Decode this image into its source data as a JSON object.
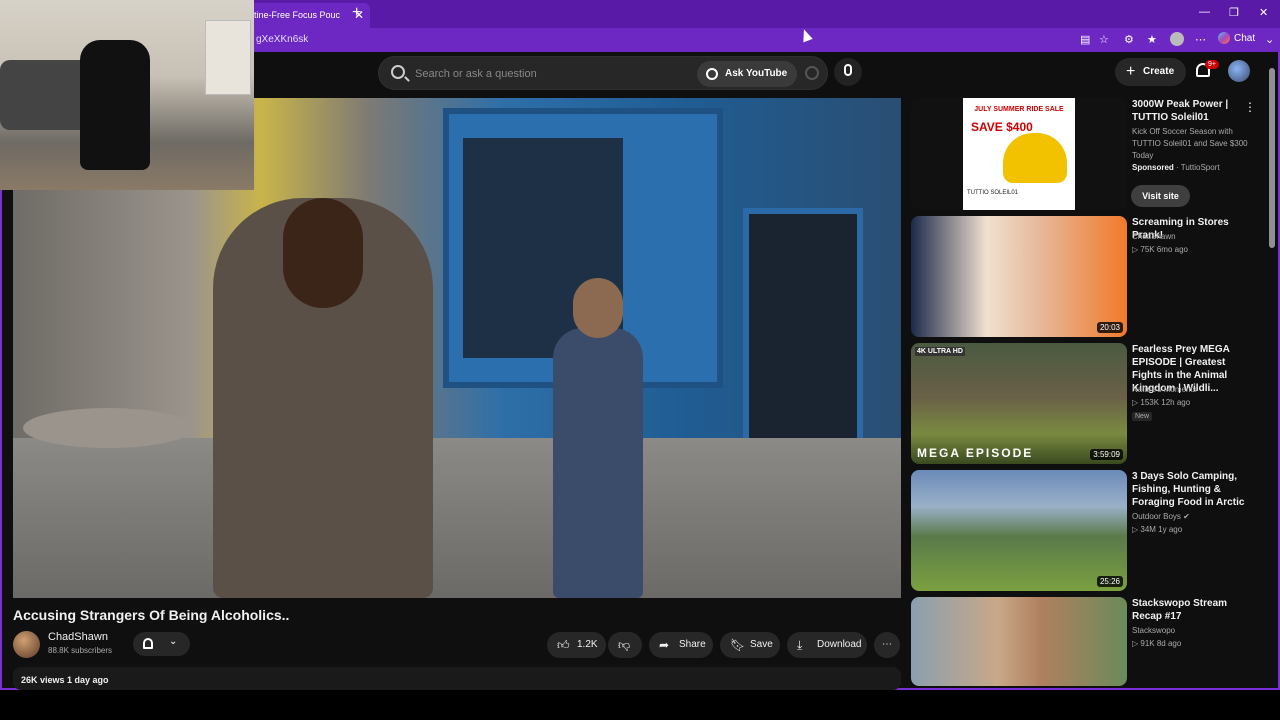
{
  "browser": {
    "tab_title": "tine-Free Focus Pouc",
    "url": "gXeXKn6sk",
    "chat_label": "Chat"
  },
  "search": {
    "placeholder": "Search or ask a question",
    "ask_label": "Ask YouTube"
  },
  "header": {
    "create_label": "Create",
    "notif_count": "9+"
  },
  "video": {
    "title": "Accusing Strangers Of Being Alcoholics..",
    "channel": "ChadShawn",
    "subscribers": "88.8K subscribers",
    "likes": "1.2K",
    "share_label": "Share",
    "save_label": "Save",
    "download_label": "Download",
    "views_date": "26K views  1 day ago"
  },
  "ad": {
    "title": "3000W Peak Power | TUTTIO Soleil01",
    "desc": "Kick Off Soccer Season with TUTTIO Soleil01 and Save $300 Today",
    "sponsor": "Sponsored",
    "advertiser": "· TuttioSport",
    "visit_label": "Visit site",
    "banner_headline": "JULY SUMMER RIDE SALE",
    "banner_save": "SAVE $400",
    "banner_brand": "TUTTIO SOLEIL01"
  },
  "recommendations": [
    {
      "title": "Screaming in Stores Prank!",
      "channel": "ChadShawn",
      "meta": "▷ 75K   6mo ago",
      "duration": "20:03"
    },
    {
      "title": "Fearless Prey MEGA EPISODE | Greatest Fights in the Animal Kingdom | Wildli...",
      "channel": "Nature's Moments",
      "meta": "▷ 153K   12h ago",
      "duration": "3:59:09",
      "badge": "New",
      "thumb_label": "MEGA EPISODE",
      "thumb_tag": "4K ULTRA HD"
    },
    {
      "title": "3 Days Solo Camping, Fishing, Hunting & Foraging Food in Arctic",
      "channel": "Outdoor Boys",
      "meta": "▷ 34M   1y ago",
      "duration": "25:26"
    },
    {
      "title": "Stackswopo Stream Recap #17",
      "channel": "Stackswopo",
      "meta": "▷ 91K   8d ago",
      "duration": ""
    }
  ],
  "colors": {
    "browser_frame": "#7b2fd6",
    "yt_bg": "#0f0f0f",
    "notif_badge": "#cc0000"
  }
}
